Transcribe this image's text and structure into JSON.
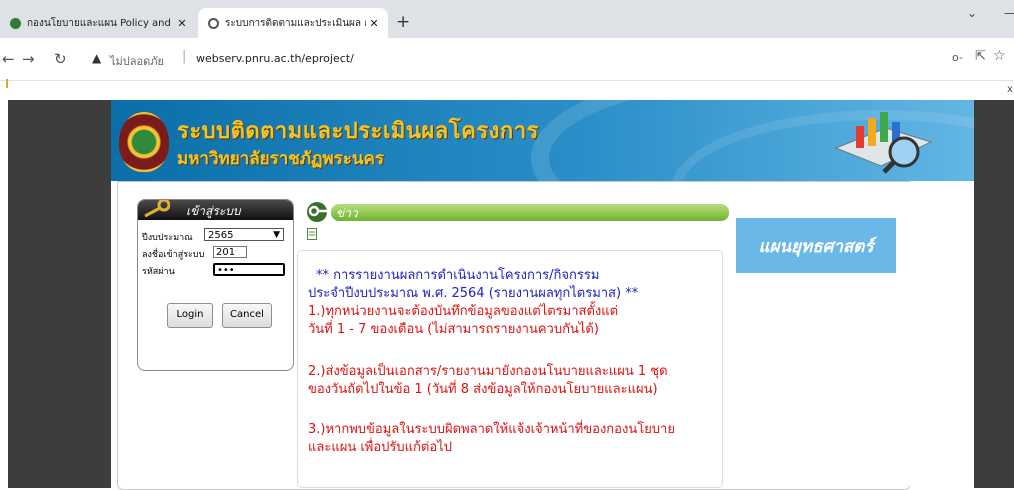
{
  "browser": {
    "tabs": [
      {
        "title": "กองนโยบายและแผน Policy and Plan",
        "active": false
      },
      {
        "title": "ระบบการติดตามและประเมินผล กองนโ",
        "active": true
      }
    ],
    "new_tab": "+",
    "tab_close": "✕",
    "window_minimize": "—",
    "window_chevron": "⌄",
    "security_label": "ไม่ปลอดภัย",
    "url": "webserv.pnru.ac.th/eproject/",
    "stray_mark": "x"
  },
  "banner": {
    "title_line1": "ระบบติดตามและประเมินผลโครงการ",
    "title_line2": "มหาวิทยาลัยราชภัฏพระนคร"
  },
  "login": {
    "title": "เข้าสู่ระบบ",
    "year_label": "ปีงบประมาณ",
    "year_value": "2565",
    "username_label": "ลงชื่อเข้าสู่ระบบ",
    "username_value": "201",
    "password_label": "รหัสผ่าน",
    "password_value": "•••",
    "login_button": "Login",
    "cancel_button": "Cancel"
  },
  "news": {
    "title": "ข่าว",
    "heading_line1": "** การรายงานผลการดำเนินงานโครงการ/กิจกรรม",
    "heading_line2": "ประจำปีงบประมาณ พ.ศ. 2564 (รายงานผลทุกไตรมาส) **",
    "item1_line1": "1.)ทุกหน่วยงานจะต้องบันทึกข้อมูลของแต่ไตรมาสตั้งแต่",
    "item1_line2": "วันที่ 1 - 7 ของเดือน (ไม่สามารถรายงานควบกันได้)",
    "item2_line1": "2.)ส่งข้อมูลเป็นเอกสาร/รายงานมายังกองนโนบายและแผน 1 ชุด",
    "item2_line2": "ของวันถัดไปในข้อ 1 (วันที่ 8 ส่งข้อมูลให้กองนโยบายและแผน)",
    "item3_line1": "3.)หากพบข้อมูลในระบบผิดพลาดให้แจ้งเจ้าหน้าที่ของกองนโยบาย",
    "item3_line2": "และแผน เพื่อปรับแก้ต่อไป"
  },
  "sidebar": {
    "strategy_label": "แผนยุทธศาสตร์"
  },
  "colors": {
    "news_heading": "#1c22c4",
    "news_items": "#e0120f",
    "banner_title": "#f6c326",
    "strategy_bg": "#6ab8e8"
  }
}
